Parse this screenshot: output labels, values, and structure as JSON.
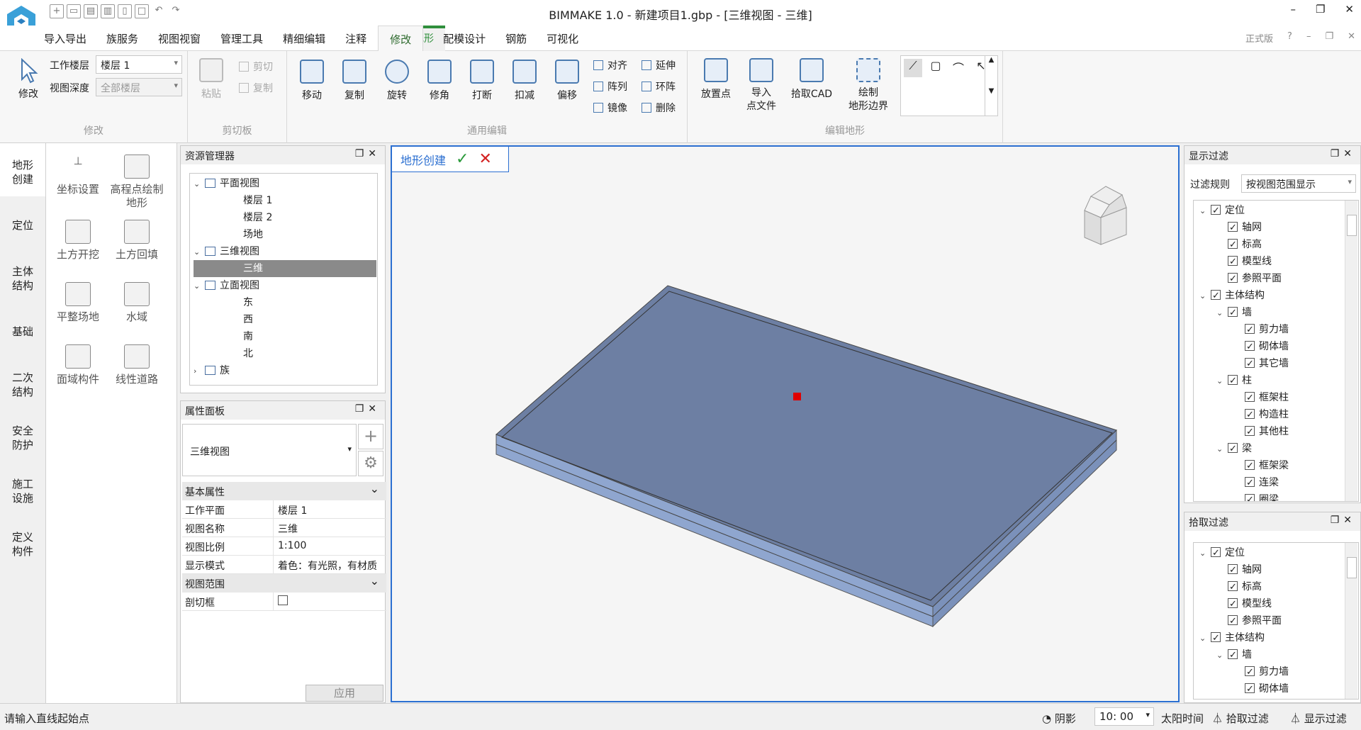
{
  "app": {
    "title": "BIMMAKE 1.0 - 新建项目1.gbp - [三维视图 - 三维]",
    "edition": "正式版"
  },
  "menu": {
    "context_tab": "编辑地形",
    "items": [
      "导入导出",
      "族服务",
      "视图视窗",
      "管理工具",
      "精细编辑",
      "注释",
      "修改",
      "配模设计",
      "钢筋",
      "可视化"
    ],
    "active": "修改"
  },
  "ribbon": {
    "modify": {
      "label": "修改",
      "btn": "修改",
      "work_level_label": "工作楼层",
      "work_level_value": "楼层 1",
      "view_depth_label": "视图深度",
      "view_depth_value": "全部楼层"
    },
    "clipboard": {
      "label": "剪切板",
      "paste": "粘贴",
      "cut": "剪切",
      "copy": "复制"
    },
    "general": {
      "label": "通用编辑",
      "move": "移动",
      "copy": "复制",
      "rotate": "旋转",
      "trim": "修角",
      "break": "打断",
      "deduct": "扣减",
      "offset": "偏移",
      "align": "对齐",
      "array": "阵列",
      "mirror": "镜像",
      "extend": "延伸",
      "ring": "环阵",
      "delete": "删除"
    },
    "terrain": {
      "label": "编辑地形",
      "place_point": "放置点",
      "import_1": "导入",
      "import_2": "点文件",
      "pick_cad": "拾取CAD",
      "draw_1": "绘制",
      "draw_2": "地形边界"
    }
  },
  "left_tabs": [
    "地形创建",
    "定位",
    "主体结构",
    "基础",
    "二次结构",
    "安全防护",
    "施工设施",
    "定义构件"
  ],
  "palette": [
    "坐标设置",
    "高程点绘制地形",
    "土方开挖",
    "土方回填",
    "平整场地",
    "水域",
    "面域构件",
    "线性道路"
  ],
  "resource_manager": {
    "title": "资源管理器",
    "items": [
      {
        "label": "平面视图",
        "level": 0,
        "expand": "v",
        "icon": true
      },
      {
        "label": "楼层 1",
        "level": 1
      },
      {
        "label": "楼层 2",
        "level": 1
      },
      {
        "label": "场地",
        "level": 1
      },
      {
        "label": "三维视图",
        "level": 0,
        "expand": "v",
        "icon": true
      },
      {
        "label": "三维",
        "level": 1,
        "selected": true
      },
      {
        "label": "立面视图",
        "level": 0,
        "expand": "v",
        "icon": true
      },
      {
        "label": "东",
        "level": 1
      },
      {
        "label": "西",
        "level": 1
      },
      {
        "label": "南",
        "level": 1
      },
      {
        "label": "北",
        "level": 1
      },
      {
        "label": "族",
        "level": 0,
        "expand": ">",
        "icon": true
      }
    ]
  },
  "properties": {
    "title": "属性面板",
    "type": "三维视图",
    "section_basic": "基本属性",
    "rows": [
      {
        "k": "工作平面",
        "v": "楼层 1"
      },
      {
        "k": "视图名称",
        "v": "三维"
      },
      {
        "k": "视图比例",
        "v": "1:100"
      },
      {
        "k": "显示模式",
        "v": "着色：有光照，有材质"
      }
    ],
    "section_range": "视图范围",
    "crop_label": "剖切框",
    "apply": "应用"
  },
  "viewport": {
    "tab": "地形创建"
  },
  "display_filter": {
    "title": "显示过滤",
    "rule_label": "过滤规则",
    "rule_value": "按视图范围显示",
    "items": [
      {
        "label": "定位",
        "level": 0
      },
      {
        "label": "轴网",
        "level": 1
      },
      {
        "label": "标高",
        "level": 1
      },
      {
        "label": "模型线",
        "level": 1
      },
      {
        "label": "参照平面",
        "level": 1
      },
      {
        "label": "主体结构",
        "level": 0
      },
      {
        "label": "墙",
        "level": 1,
        "expand": true
      },
      {
        "label": "剪力墙",
        "level": 2
      },
      {
        "label": "砌体墙",
        "level": 2
      },
      {
        "label": "其它墙",
        "level": 2
      },
      {
        "label": "柱",
        "level": 1,
        "expand": true
      },
      {
        "label": "框架柱",
        "level": 2
      },
      {
        "label": "构造柱",
        "level": 2
      },
      {
        "label": "其他柱",
        "level": 2
      },
      {
        "label": "梁",
        "level": 1,
        "expand": true
      },
      {
        "label": "框架梁",
        "level": 2
      },
      {
        "label": "连梁",
        "level": 2
      },
      {
        "label": "圈梁",
        "level": 2
      }
    ]
  },
  "pick_filter": {
    "title": "拾取过滤",
    "items": [
      {
        "label": "定位",
        "level": 0
      },
      {
        "label": "轴网",
        "level": 1
      },
      {
        "label": "标高",
        "level": 1
      },
      {
        "label": "模型线",
        "level": 1
      },
      {
        "label": "参照平面",
        "level": 1
      },
      {
        "label": "主体结构",
        "level": 0
      },
      {
        "label": "墙",
        "level": 1,
        "expand": true
      },
      {
        "label": "剪力墙",
        "level": 2
      },
      {
        "label": "砌体墙",
        "level": 2
      }
    ]
  },
  "status": {
    "message": "请输入直线起始点",
    "shadow": "阴影",
    "time": "10: 00",
    "sun_time": "太阳时间",
    "pick_filter": "拾取过滤",
    "display_filter": "显示过滤"
  },
  "colors": {
    "accent": "#2b6fd1",
    "context": "#2f8f3c",
    "slab_top": "#6d7fa3",
    "slab_side": "#8fa6cf"
  }
}
